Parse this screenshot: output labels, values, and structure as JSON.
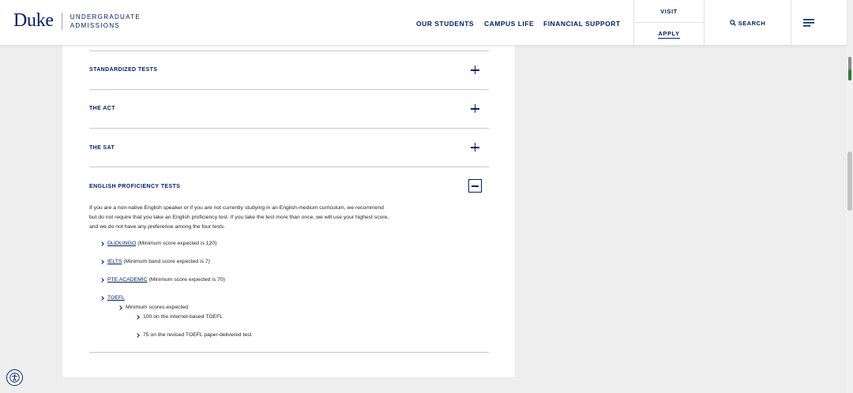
{
  "header": {
    "logo_word": "Duke",
    "logo_sub_line1": "UNDERGRADUATE",
    "logo_sub_line2": "ADMISSIONS",
    "nav": [
      "OUR STUDENTS",
      "CAMPUS LIFE",
      "FINANCIAL SUPPORT"
    ],
    "visit_label": "VISIT",
    "apply_label": "APPLY",
    "search_label": "SEARCH"
  },
  "accordion": {
    "sections": [
      {
        "title": "STANDARDIZED TESTS",
        "state": "collapsed"
      },
      {
        "title": "THE ACT",
        "state": "collapsed"
      },
      {
        "title": "THE SAT",
        "state": "collapsed"
      },
      {
        "title": "ENGLISH PROFICIENCY TESTS",
        "state": "expanded"
      }
    ],
    "expanded": {
      "intro_line1": "If you are a non-native English speaker or if you are not currently studying in an English-medium curriculum, we recommend",
      "intro_line2": "but do not require that you take an English proficiency test. If you take the test more than once, we will use your highest score,",
      "intro_line3": "and we do not have any preference among the four tests.",
      "tests": [
        {
          "name": "DUOLINGO",
          "note": "(Minimum score expected is 120)"
        },
        {
          "name": "IELTS",
          "note": "(Minimum band score expected is 7)"
        },
        {
          "name": "PTE ACADEMIC",
          "note": "(Minimum score expected is 70)"
        },
        {
          "name": "TOEFL",
          "note": ""
        }
      ],
      "toefl_sub": "Minimum scores expected:",
      "toefl_scores": [
        "100 on the internet-based TOEFL",
        "75 on the revised TOEFL paper-delivered test"
      ]
    }
  },
  "colors": {
    "brand": "#012169",
    "page_bg": "#eeeeee",
    "card_bg": "#ffffff"
  },
  "icons": [
    "search-icon",
    "menu-icon",
    "plus-icon",
    "minus-icon",
    "chevron-right-icon",
    "accessibility-icon"
  ]
}
